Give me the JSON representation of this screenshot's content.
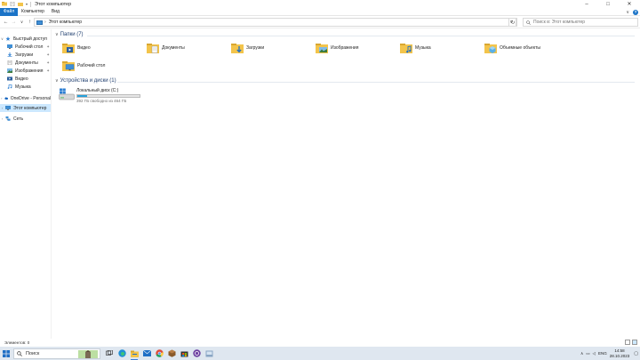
{
  "window": {
    "title": "Этот компьютер",
    "controls": {
      "minimize": "–",
      "maximize": "□",
      "close": "✕"
    }
  },
  "ribbon": {
    "tabs": [
      {
        "label": "Файл",
        "active": true
      },
      {
        "label": "Компьютер"
      },
      {
        "label": "Вид"
      }
    ],
    "expand_icon": "chevron-down-icon",
    "help": "?"
  },
  "nav": {
    "back": "←",
    "forward": "→",
    "recent": "∨",
    "up": "↑",
    "address_path": "Этот компьютер",
    "address_sep": "›",
    "dropdown": "∨",
    "refresh": "↻",
    "search_placeholder": "Поиск в: Этот компьютер"
  },
  "sidebar": {
    "items": [
      {
        "label": "Быстрый доступ",
        "icon": "star-icon",
        "chev": "∨"
      },
      {
        "label": "Рабочий стол",
        "icon": "desktop-folder-icon",
        "pinned": true
      },
      {
        "label": "Загрузки",
        "icon": "downloads-icon",
        "pinned": true
      },
      {
        "label": "Документы",
        "icon": "documents-icon",
        "pinned": true
      },
      {
        "label": "Изображения",
        "icon": "pictures-icon",
        "pinned": true
      },
      {
        "label": "Видео",
        "icon": "videos-folder-icon"
      },
      {
        "label": "Музыка",
        "icon": "music-icon"
      },
      {
        "label": "OneDrive - Personal",
        "icon": "onedrive-icon",
        "chev": "›"
      },
      {
        "label": "Этот компьютер",
        "icon": "computer-icon",
        "chev": "›",
        "selected": true
      },
      {
        "label": "Сеть",
        "icon": "network-icon",
        "chev": "›"
      }
    ],
    "pin_glyph": "📌"
  },
  "main": {
    "folders_header": "Папки (7)",
    "folders": [
      {
        "label": "Видео",
        "icon": "videos-folder-icon"
      },
      {
        "label": "Документы",
        "icon": "documents-folder-icon"
      },
      {
        "label": "Загрузки",
        "icon": "downloads-folder-icon"
      },
      {
        "label": "Изображения",
        "icon": "pictures-folder-icon"
      },
      {
        "label": "Музыка",
        "icon": "music-folder-icon"
      },
      {
        "label": "Объемные объекты",
        "icon": "3d-objects-folder-icon"
      },
      {
        "label": "Рабочий стол",
        "icon": "desktop-folder-icon"
      }
    ],
    "devices_header": "Устройства и диски (1)",
    "drives": [
      {
        "label": "Локальный диск (C:)",
        "free_text": "392 ГБ свободно из 464 ГБ",
        "used_fraction": 0.155
      }
    ]
  },
  "status": {
    "items_text": "Элементов: 0"
  },
  "taskbar": {
    "search_label": "Поиск",
    "apps": [
      "task-view-icon",
      "edge-icon",
      "file-explorer-icon",
      "mail-icon",
      "chrome-icon",
      "package-icon",
      "store-icon",
      "outlook-icon",
      "app-icon"
    ],
    "language": "ENG",
    "time": "14:58",
    "date": "28.10.2023"
  },
  "colors": {
    "accent": "#1a73c7",
    "folder": "#f3c44b",
    "selection": "#cce8ff",
    "drive_bar": "#26a0da",
    "taskbar": "#dfe7f0"
  }
}
